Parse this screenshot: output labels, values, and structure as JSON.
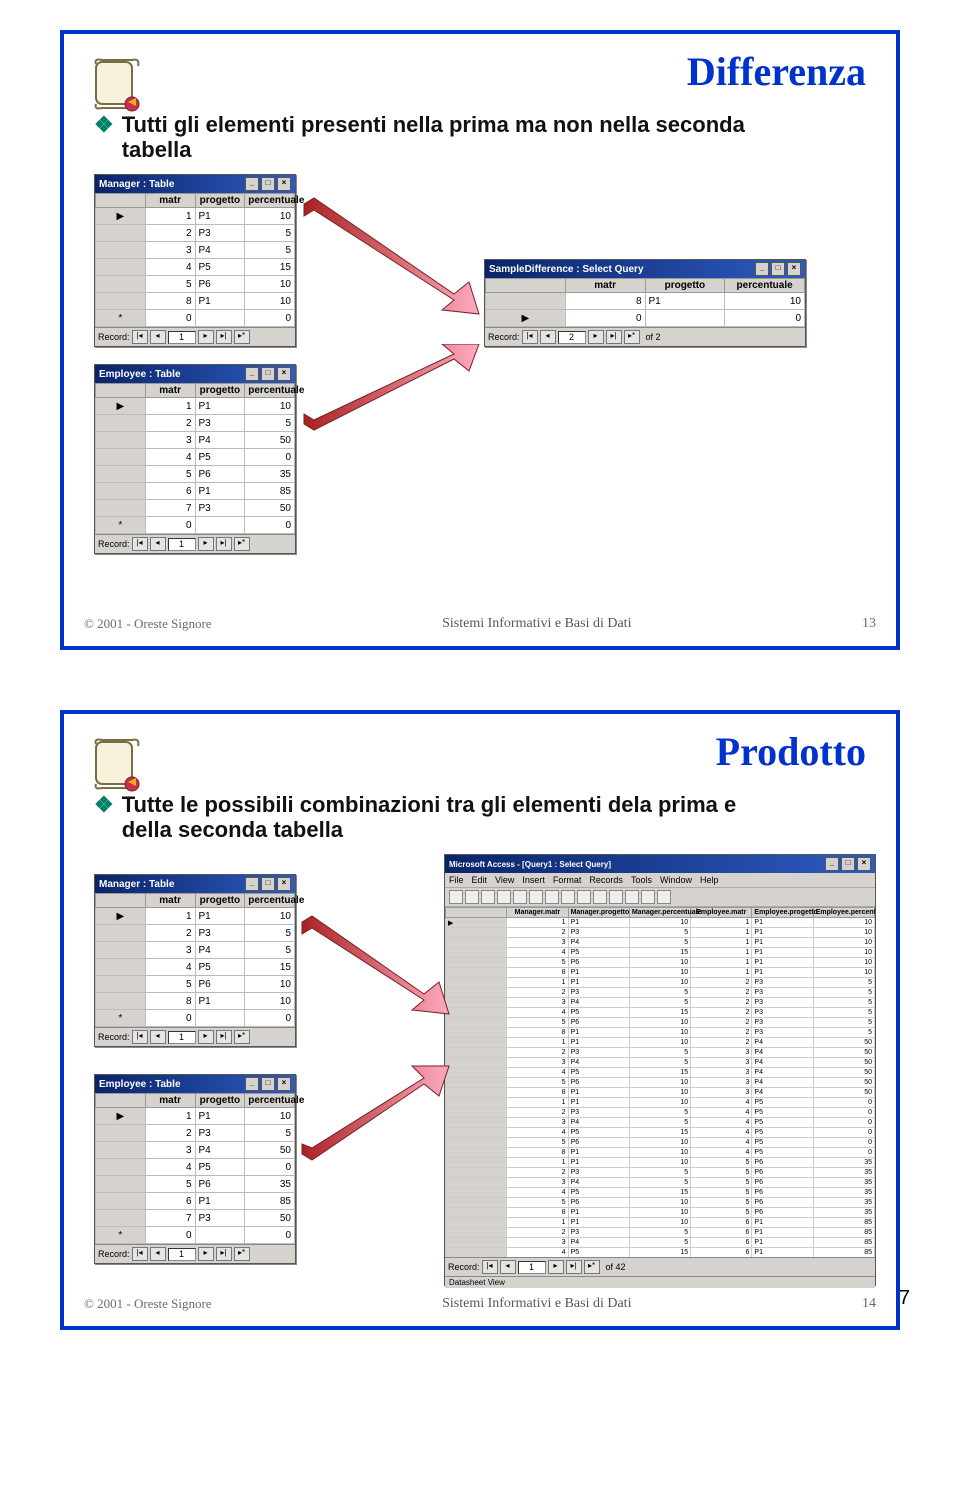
{
  "global": {
    "pageNumber": "7",
    "copyright": "© 2001 - Oreste Signore",
    "footerCenter": "Sistemi Informativi e Basi di Dati"
  },
  "slide1": {
    "number": "13",
    "title": "Differenza",
    "bullet": "Tutti gli elementi presenti nella prima ma non nella seconda tabella",
    "managerWin": {
      "title": "Manager : Table",
      "cols": [
        "",
        "matr",
        "progetto",
        "percentuale"
      ],
      "rows": [
        [
          "▶",
          "1",
          "P1",
          "10"
        ],
        [
          "",
          "2",
          "P3",
          "5"
        ],
        [
          "",
          "3",
          "P4",
          "5"
        ],
        [
          "",
          "4",
          "P5",
          "15"
        ],
        [
          "",
          "5",
          "P6",
          "10"
        ],
        [
          "",
          "8",
          "P1",
          "10"
        ],
        [
          "*",
          "0",
          "",
          "0"
        ]
      ],
      "nav": {
        "label": "Record:",
        "value": "1"
      }
    },
    "employeeWin": {
      "title": "Employee : Table",
      "cols": [
        "",
        "matr",
        "progetto",
        "percentuale"
      ],
      "rows": [
        [
          "▶",
          "1",
          "P1",
          "10"
        ],
        [
          "",
          "2",
          "P3",
          "5"
        ],
        [
          "",
          "3",
          "P4",
          "50"
        ],
        [
          "",
          "4",
          "P5",
          "0"
        ],
        [
          "",
          "5",
          "P6",
          "35"
        ],
        [
          "",
          "6",
          "P1",
          "85"
        ],
        [
          "",
          "7",
          "P3",
          "50"
        ],
        [
          "*",
          "0",
          "",
          "0"
        ]
      ],
      "nav": {
        "label": "Record:",
        "value": "1"
      }
    },
    "resultWin": {
      "title": "SampleDifference : Select Query",
      "cols": [
        "",
        "matr",
        "progetto",
        "percentuale"
      ],
      "rows": [
        [
          "",
          "8",
          "P1",
          "10"
        ],
        [
          "▶",
          "0",
          "",
          "0"
        ]
      ],
      "nav": {
        "label": "Record:",
        "value": "2",
        "total": "of 2"
      }
    }
  },
  "slide2": {
    "number": "14",
    "title": "Prodotto",
    "bullet": "Tutte le possibili combinazioni tra gli elementi dela prima e della seconda tabella",
    "managerWin": {
      "title": "Manager : Table",
      "cols": [
        "",
        "matr",
        "progetto",
        "percentuale"
      ],
      "rows": [
        [
          "▶",
          "1",
          "P1",
          "10"
        ],
        [
          "",
          "2",
          "P3",
          "5"
        ],
        [
          "",
          "3",
          "P4",
          "5"
        ],
        [
          "",
          "4",
          "P5",
          "15"
        ],
        [
          "",
          "5",
          "P6",
          "10"
        ],
        [
          "",
          "8",
          "P1",
          "10"
        ],
        [
          "*",
          "0",
          "",
          "0"
        ]
      ],
      "nav": {
        "label": "Record:",
        "value": "1"
      }
    },
    "employeeWin": {
      "title": "Employee : Table",
      "cols": [
        "",
        "matr",
        "progetto",
        "percentuale"
      ],
      "rows": [
        [
          "▶",
          "1",
          "P1",
          "10"
        ],
        [
          "",
          "2",
          "P3",
          "5"
        ],
        [
          "",
          "3",
          "P4",
          "50"
        ],
        [
          "",
          "4",
          "P5",
          "0"
        ],
        [
          "",
          "5",
          "P6",
          "35"
        ],
        [
          "",
          "6",
          "P1",
          "85"
        ],
        [
          "",
          "7",
          "P3",
          "50"
        ],
        [
          "*",
          "0",
          "",
          "0"
        ]
      ],
      "nav": {
        "label": "Record:",
        "value": "1"
      }
    },
    "bigWin": {
      "title": "Microsoft Access - [Query1 : Select Query]",
      "menu": [
        "File",
        "Edit",
        "View",
        "Insert",
        "Format",
        "Records",
        "Tools",
        "Window",
        "Help"
      ],
      "cols": [
        "",
        "Manager.matr",
        "Manager.progetto",
        "Manager.percentuale",
        "Employee.matr",
        "Employee.progetto",
        "Employee.percentuale"
      ],
      "rows": [
        [
          "▶",
          "1",
          "P1",
          "10",
          "1",
          "P1",
          "10"
        ],
        [
          "",
          "2",
          "P3",
          "5",
          "1",
          "P1",
          "10"
        ],
        [
          "",
          "3",
          "P4",
          "5",
          "1",
          "P1",
          "10"
        ],
        [
          "",
          "4",
          "P5",
          "15",
          "1",
          "P1",
          "10"
        ],
        [
          "",
          "5",
          "P6",
          "10",
          "1",
          "P1",
          "10"
        ],
        [
          "",
          "8",
          "P1",
          "10",
          "1",
          "P1",
          "10"
        ],
        [
          "",
          "1",
          "P1",
          "10",
          "2",
          "P3",
          "5"
        ],
        [
          "",
          "2",
          "P3",
          "5",
          "2",
          "P3",
          "5"
        ],
        [
          "",
          "3",
          "P4",
          "5",
          "2",
          "P3",
          "5"
        ],
        [
          "",
          "4",
          "P5",
          "15",
          "2",
          "P3",
          "5"
        ],
        [
          "",
          "5",
          "P6",
          "10",
          "2",
          "P3",
          "5"
        ],
        [
          "",
          "8",
          "P1",
          "10",
          "2",
          "P3",
          "5"
        ],
        [
          "",
          "1",
          "P1",
          "10",
          "2",
          "P4",
          "50"
        ],
        [
          "",
          "2",
          "P3",
          "5",
          "3",
          "P4",
          "50"
        ],
        [
          "",
          "3",
          "P4",
          "5",
          "3",
          "P4",
          "50"
        ],
        [
          "",
          "4",
          "P5",
          "15",
          "3",
          "P4",
          "50"
        ],
        [
          "",
          "5",
          "P6",
          "10",
          "3",
          "P4",
          "50"
        ],
        [
          "",
          "8",
          "P1",
          "10",
          "3",
          "P4",
          "50"
        ],
        [
          "",
          "1",
          "P1",
          "10",
          "4",
          "P5",
          "0"
        ],
        [
          "",
          "2",
          "P3",
          "5",
          "4",
          "P5",
          "0"
        ],
        [
          "",
          "3",
          "P4",
          "5",
          "4",
          "P5",
          "0"
        ],
        [
          "",
          "4",
          "P5",
          "15",
          "4",
          "P5",
          "0"
        ],
        [
          "",
          "5",
          "P6",
          "10",
          "4",
          "P5",
          "0"
        ],
        [
          "",
          "8",
          "P1",
          "10",
          "4",
          "P5",
          "0"
        ],
        [
          "",
          "1",
          "P1",
          "10",
          "5",
          "P6",
          "35"
        ],
        [
          "",
          "2",
          "P3",
          "5",
          "5",
          "P6",
          "35"
        ],
        [
          "",
          "3",
          "P4",
          "5",
          "5",
          "P6",
          "35"
        ],
        [
          "",
          "4",
          "P5",
          "15",
          "5",
          "P6",
          "35"
        ],
        [
          "",
          "5",
          "P6",
          "10",
          "5",
          "P6",
          "35"
        ],
        [
          "",
          "8",
          "P1",
          "10",
          "5",
          "P6",
          "35"
        ],
        [
          "",
          "1",
          "P1",
          "10",
          "6",
          "P1",
          "85"
        ],
        [
          "",
          "2",
          "P3",
          "5",
          "6",
          "P1",
          "85"
        ],
        [
          "",
          "3",
          "P4",
          "5",
          "6",
          "P1",
          "85"
        ],
        [
          "",
          "4",
          "P5",
          "15",
          "6",
          "P1",
          "85"
        ]
      ],
      "nav": {
        "label": "Record:",
        "value": "1",
        "total": "of 42"
      },
      "status": "Datasheet View"
    }
  }
}
